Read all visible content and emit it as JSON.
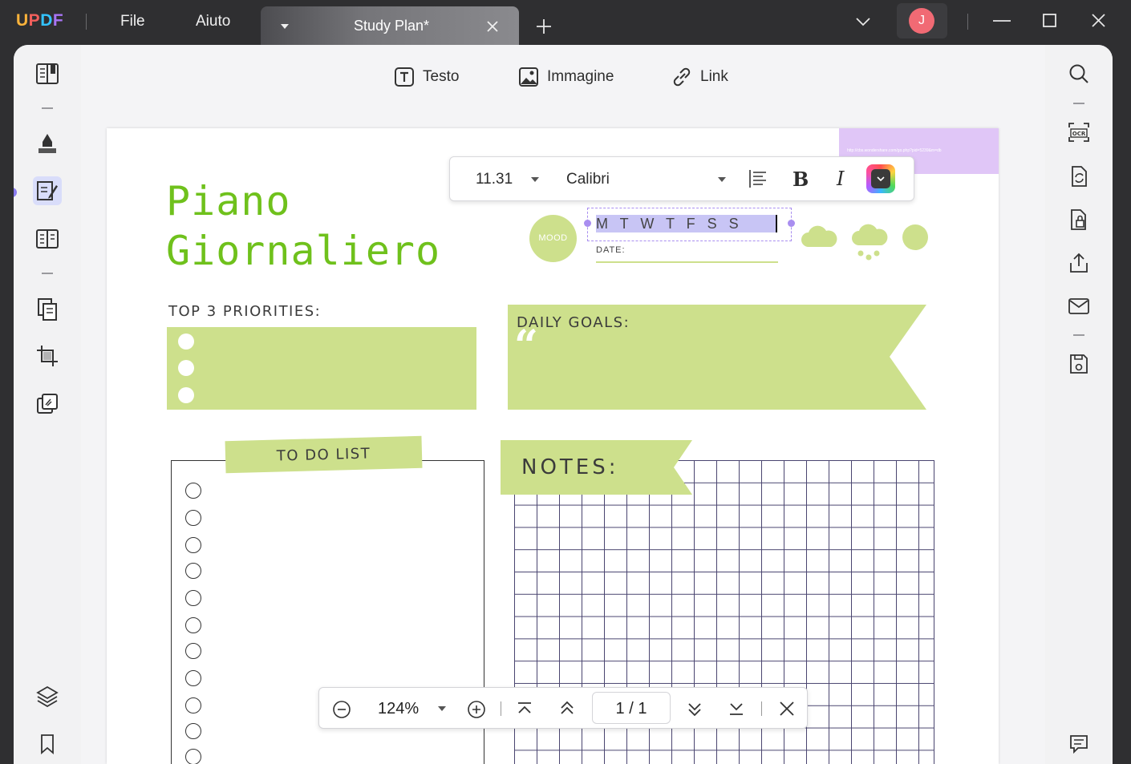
{
  "app": {
    "logo": "UPDF",
    "logo_colors": [
      "#fbb33b",
      "#f25f5c",
      "#33c3ff",
      "#a874f5"
    ]
  },
  "menu": {
    "file": "File",
    "help": "Aiuto"
  },
  "tab": {
    "title": "Study Plan*"
  },
  "user": {
    "initial": "J",
    "avatar_color": "#f16a74"
  },
  "edit_tools": {
    "text": "Testo",
    "image": "Immagine",
    "link": "Link"
  },
  "format_bar": {
    "font_size": "11.31",
    "font_name": "Calibri",
    "bold": "B",
    "italic": "I"
  },
  "document": {
    "title_line1": "Piano",
    "title_line2": "Giornaliero",
    "mood": "MOOD",
    "weekdays": "M T W T F S S",
    "date_label": "DATE:",
    "priorities_label": "TOP 3 PRIORITIES:",
    "goals_label": "DAILY GOALS:",
    "quote_mark": "“",
    "todo_label": "TO DO LIST",
    "notes_label": "NOTES:",
    "watermark_url": "http://cbs.wondershare.com/go.php?pid=5239&m=db"
  },
  "zoom_bar": {
    "zoom": "124%",
    "page": "1 / 1"
  },
  "colors": {
    "accent_green": "#6fc11c",
    "pale_green": "#cde08c",
    "selection": "#c8c5f5",
    "purple_band": "#e0c6f7"
  }
}
